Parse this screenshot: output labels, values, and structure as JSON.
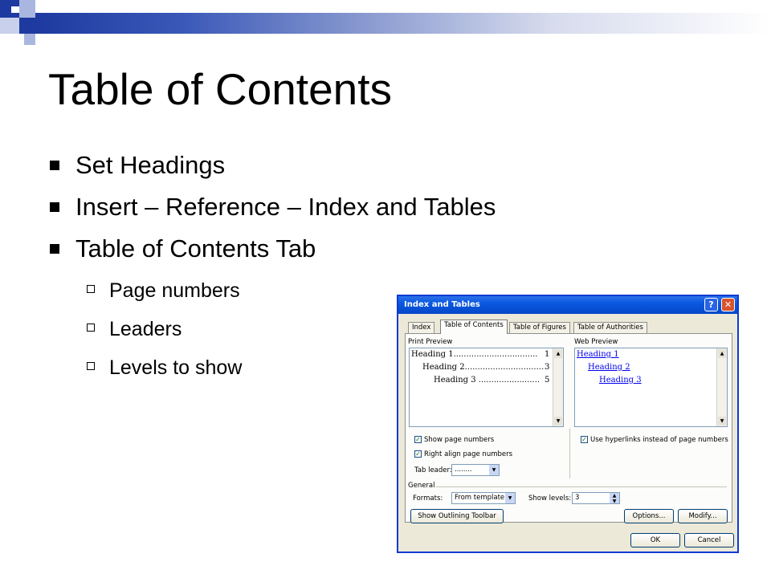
{
  "slide": {
    "title": "Table of Contents",
    "bullets": [
      "Set Headings",
      "Insert – Reference – Index and Tables",
      "Table of Contents Tab"
    ],
    "sub_bullets": [
      "Page numbers",
      "Leaders",
      "Levels to show"
    ]
  },
  "colors": {
    "header_blue": "#1e3aa0",
    "title_bar_blue": "#0a58e0",
    "link_blue": "#0000ee"
  },
  "dialog": {
    "title": "Index and Tables",
    "help_label": "?",
    "close_label": "✕",
    "tabs": [
      {
        "label": "Index",
        "active": false
      },
      {
        "label": "Table of Contents",
        "active": true
      },
      {
        "label": "Table of Figures",
        "active": false
      },
      {
        "label": "Table of Authorities",
        "active": false
      }
    ],
    "print_preview": {
      "label": "Print Preview",
      "lines": [
        {
          "text": "Heading 1.................................",
          "page": "1"
        },
        {
          "text": "Heading 2...............................",
          "page": "3"
        },
        {
          "text": "Heading 3 ........................",
          "page": "5"
        }
      ]
    },
    "web_preview": {
      "label": "Web Preview",
      "links": [
        "Heading 1",
        "Heading 2",
        "Heading 3"
      ]
    },
    "show_page_numbers": {
      "label": "Show page numbers",
      "checked": true
    },
    "right_align": {
      "label": "Right align page numbers",
      "checked": true
    },
    "use_hyperlinks": {
      "label": "Use hyperlinks instead of page numbers",
      "checked": true
    },
    "tab_leader": {
      "label": "Tab leader:",
      "value": "........"
    },
    "general_label": "General",
    "formats": {
      "label": "Formats:",
      "value": "From template"
    },
    "show_levels": {
      "label": "Show levels:",
      "value": "3"
    },
    "buttons": {
      "outlining": "Show Outlining Toolbar",
      "options": "Options...",
      "modify": "Modify...",
      "ok": "OK",
      "cancel": "Cancel"
    }
  }
}
